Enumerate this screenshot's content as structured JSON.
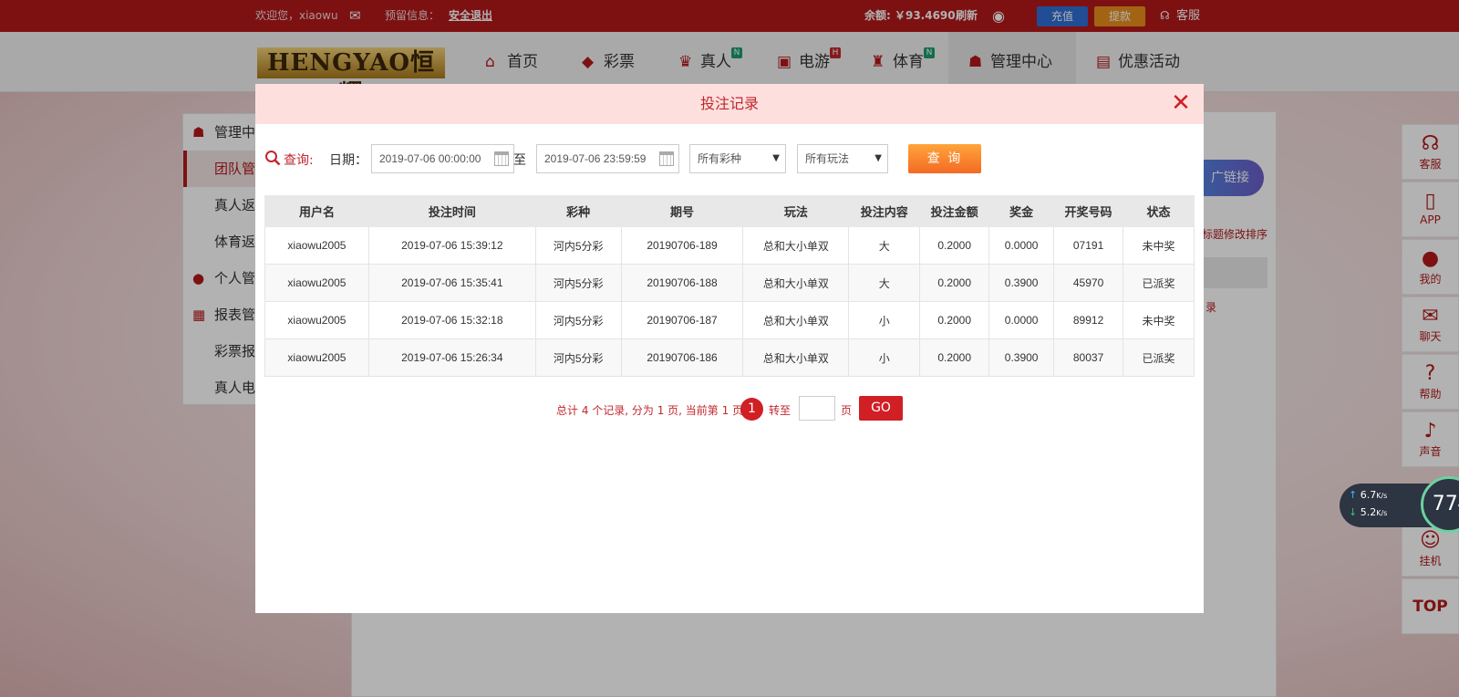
{
  "topbar": {
    "welcome": "欢迎您，xiaowu",
    "notice_label": "预留信息：",
    "logout": "安全退出",
    "balance_label": "余额: ￥93.4690",
    "refresh": "刷新",
    "deposit": "充值",
    "withdraw": "提款",
    "service": "客服"
  },
  "logo": {
    "text": "HENGYAO恒耀"
  },
  "nav": {
    "items": [
      {
        "label": "首页",
        "icon": "home-icon",
        "badge": ""
      },
      {
        "label": "彩票",
        "icon": "ticket-icon",
        "badge": ""
      },
      {
        "label": "真人",
        "icon": "dealer-icon",
        "badge": "N"
      },
      {
        "label": "电游",
        "icon": "slot-machine-icon",
        "badge": "H"
      },
      {
        "label": "体育",
        "icon": "trophy-icon",
        "badge": "N"
      },
      {
        "label": "管理中心",
        "icon": "users-icon",
        "badge": ""
      },
      {
        "label": "优惠活动",
        "icon": "gift-icon",
        "badge": ""
      }
    ]
  },
  "sidebar": {
    "items": [
      {
        "label": "管理中心"
      },
      {
        "label": "团队管"
      },
      {
        "label": "真人返"
      },
      {
        "label": "体育返"
      },
      {
        "label": "个人管"
      },
      {
        "label": "报表管"
      },
      {
        "label": "彩票报"
      },
      {
        "label": "真人电"
      }
    ]
  },
  "background": {
    "promo_link": "广链接",
    "sort_hint": "标题修改排序",
    "record_fragment": "录"
  },
  "right_bar": {
    "items": [
      {
        "label": "客服",
        "icon": "headset-icon"
      },
      {
        "label": "APP",
        "icon": "phone-icon"
      },
      {
        "label": "我的",
        "icon": "user-icon"
      },
      {
        "label": "聊天",
        "icon": "chat-icon"
      },
      {
        "label": "帮助",
        "icon": "help-icon"
      },
      {
        "label": "声音",
        "icon": "speaker-icon"
      },
      {
        "label": "挂机",
        "icon": "robot-icon"
      }
    ],
    "top": "TOP"
  },
  "net_widget": {
    "upload": "6.7",
    "download": "5.2",
    "unit": "K/s",
    "percent": "77",
    "percent_sign": "%"
  },
  "modal": {
    "title": "投注记录",
    "query_label": "查询:",
    "date_label": "日期：",
    "date_from": "2019-07-06 00:00:00",
    "to_label": "至",
    "date_to": "2019-07-06 23:59:59",
    "lottery_select": "所有彩种",
    "play_select": "所有玩法",
    "query_button": "查 询"
  },
  "table": {
    "headers": [
      "用户名",
      "投注时间",
      "彩种",
      "期号",
      "玩法",
      "投注内容",
      "投注金额",
      "奖金",
      "开奖号码",
      "状态"
    ],
    "rows": [
      [
        "xiaowu2005",
        "2019-07-06 15:39:12",
        "河内5分彩",
        "20190706-189",
        "总和大小单双",
        "大",
        "0.2000",
        "0.0000",
        "07191",
        "未中奖"
      ],
      [
        "xiaowu2005",
        "2019-07-06 15:35:41",
        "河内5分彩",
        "20190706-188",
        "总和大小单双",
        "大",
        "0.2000",
        "0.3900",
        "45970",
        "已派奖"
      ],
      [
        "xiaowu2005",
        "2019-07-06 15:32:18",
        "河内5分彩",
        "20190706-187",
        "总和大小单双",
        "小",
        "0.2000",
        "0.0000",
        "89912",
        "未中奖"
      ],
      [
        "xiaowu2005",
        "2019-07-06 15:26:34",
        "河内5分彩",
        "20190706-186",
        "总和大小单双",
        "小",
        "0.2000",
        "0.3900",
        "80037",
        "已派奖"
      ]
    ]
  },
  "pager": {
    "summary": "总计 4 个记录, 分为 1 页, 当前第 1 页",
    "current": "1",
    "goto_label": "转至",
    "page_suffix": "页",
    "go_button": "GO"
  },
  "colors": {
    "brand_red": "#b3191b",
    "accent_red": "#d01f25",
    "modal_header_bg": "#fde0de",
    "query_button": "#f36a24"
  }
}
